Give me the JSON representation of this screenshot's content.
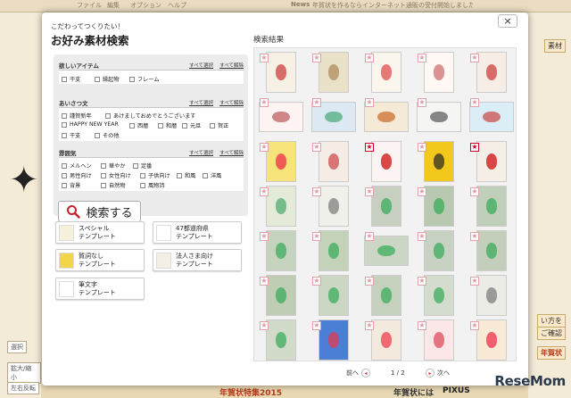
{
  "background": {
    "top_bar": [
      "ファイル",
      "編集",
      "オプション",
      "ヘルプ",
      "News",
      "年賀状を作るならインターネット通販の受付開始しました。"
    ],
    "left_buttons": [
      "選択",
      "拡大/縮小",
      "左右反転"
    ],
    "right_labels": [
      "素材",
      "い方を",
      "ご確認",
      "年賀状"
    ],
    "bottom_banners": [
      "年賀状特集2015",
      "年賀状には",
      "PIXUS"
    ]
  },
  "modal": {
    "close_label": "×",
    "subtitle": "こだわってつくりたい！",
    "title": "お好み素材検索",
    "select_all": "すべて選択",
    "clear_all": "すべて解除",
    "sections": [
      {
        "title": "欲しいアイテム",
        "options": [
          "干支",
          "縁起物",
          "フレーム"
        ]
      },
      {
        "title": "あいさつ文",
        "options": [
          "謹賀新年",
          "あけましておめでとうございます",
          "HAPPY NEW YEAR",
          "西暦",
          "和暦",
          "元旦",
          "賀正",
          "干支",
          "その他"
        ]
      },
      {
        "title": "雰囲気",
        "options": [
          "メルヘン",
          "華やか",
          "定番",
          "男性向け",
          "女性向け",
          "子供向け",
          "和風",
          "洋風",
          "背景",
          "自然物",
          "風物詩"
        ]
      }
    ],
    "search_button": "検索する",
    "templates": [
      {
        "label": "スペシャル\nテンプレート",
        "icon": "special-template-icon"
      },
      {
        "label": "47都道府県\nテンプレート",
        "icon": "prefecture-template-icon"
      },
      {
        "label": "賀詞なし\nテンプレート",
        "icon": "no-greeting-template-icon"
      },
      {
        "label": "法人さま向け\nテンプレート",
        "icon": "corporate-template-icon"
      },
      {
        "label": "筆文字\nテンプレート",
        "icon": "brush-template-icon"
      }
    ],
    "results_title": "検索結果",
    "results": [
      {
        "color": "#f6f1e4",
        "accent": "#c33",
        "starred": false
      },
      {
        "color": "#e9e2c8",
        "accent": "#a85",
        "starred": false
      },
      {
        "color": "#faf6ee",
        "accent": "#d44",
        "starred": false
      },
      {
        "color": "#fff8f5",
        "accent": "#c66",
        "starred": false
      },
      {
        "color": "#f6eee6",
        "accent": "#c33",
        "starred": false
      },
      {
        "color": "#fdf3f3",
        "accent": "#b55",
        "starred": false
      },
      {
        "color": "#dce8f2",
        "accent": "#4a7",
        "starred": false
      },
      {
        "color": "#f4ead6",
        "accent": "#c62",
        "starred": false
      },
      {
        "color": "#f5f5f3",
        "accent": "#555",
        "starred": false
      },
      {
        "color": "#dbeef8",
        "accent": "#c44",
        "starred": false
      },
      {
        "color": "#f6e37a",
        "accent": "#e24",
        "starred": false
      },
      {
        "color": "#f6ece6",
        "accent": "#c44",
        "starred": false
      },
      {
        "color": "#fbf4f2",
        "accent": "#c00",
        "starred": true
      },
      {
        "color": "#f3c81c",
        "accent": "#222",
        "starred": false
      },
      {
        "color": "#f5efe8",
        "accent": "#c00",
        "starred": true
      },
      {
        "color": "#e3ead8",
        "accent": "#4a6",
        "starred": false
      },
      {
        "color": "#f1f1ec",
        "accent": "#777",
        "starred": false
      },
      {
        "color": "#c7d0c0",
        "accent": "#3a5",
        "starred": false
      },
      {
        "color": "#b9c8b0",
        "accent": "#3a5",
        "starred": false
      },
      {
        "color": "#c0cfb9",
        "accent": "#3a5",
        "starred": false
      },
      {
        "color": "#c5d3bf",
        "accent": "#3a5",
        "starred": false
      },
      {
        "color": "#c4d2ba",
        "accent": "#3a5",
        "starred": false
      },
      {
        "color": "#ccd6c4",
        "accent": "#3a5",
        "starred": false
      },
      {
        "color": "#c8d2c2",
        "accent": "#3a5",
        "starred": false
      },
      {
        "color": "#c3cfba",
        "accent": "#3a5",
        "starred": false
      },
      {
        "color": "#bfcdb4",
        "accent": "#3a5",
        "starred": false
      },
      {
        "color": "#cbd6c3",
        "accent": "#3a5",
        "starred": false
      },
      {
        "color": "#c5d1bc",
        "accent": "#3a5",
        "starred": false
      },
      {
        "color": "#d4dccd",
        "accent": "#3a5",
        "starred": false
      },
      {
        "color": "#ecece6",
        "accent": "#777",
        "starred": false
      },
      {
        "color": "#d2dbc9",
        "accent": "#3a5",
        "starred": false
      },
      {
        "color": "#4b7fd6",
        "accent": "#e34",
        "starred": false
      },
      {
        "color": "#f3e9dc",
        "accent": "#e34",
        "starred": false
      },
      {
        "color": "#fbe6e8",
        "accent": "#d45",
        "starred": false
      },
      {
        "color": "#f8ead7",
        "accent": "#e24",
        "starred": false
      }
    ],
    "pager": {
      "prev": "前へ",
      "page": "1 / 2",
      "next": "次へ"
    }
  },
  "watermark": "ReseMom"
}
